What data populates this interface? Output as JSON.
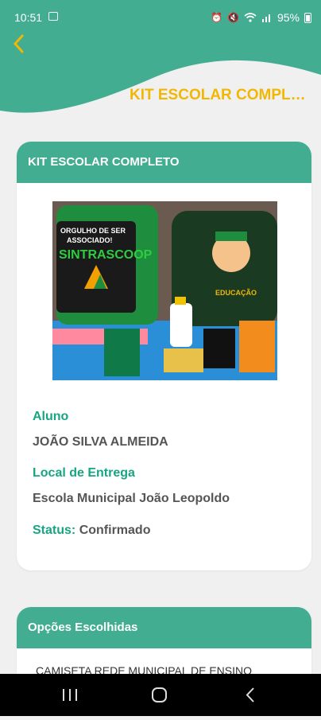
{
  "status_bar": {
    "time": "10:51",
    "battery": "95%",
    "icons": [
      "image-icon",
      "alarm-icon",
      "mute-icon",
      "wifi-icon",
      "volte-icon",
      "signal-icon",
      "battery-icon"
    ]
  },
  "header": {
    "title": "KIT ESCOLAR COMPLETO",
    "back_icon": "chevron-left-icon",
    "accent_color": "#f2b705",
    "brand_color": "#43ad91"
  },
  "kit_card": {
    "title": "KIT ESCOLAR COMPLETO",
    "image_alt": "Mochilas e material escolar",
    "aluno_label": "Aluno",
    "aluno_value": "JOÃO SILVA ALMEIDA",
    "local_label": "Local de Entrega",
    "local_value": "Escola Municipal João Leopoldo",
    "status_label": "Status:",
    "status_value": "Confirmado"
  },
  "options_card": {
    "title": "Opções Escolhidas",
    "items": [
      "CAMISETA REDE MUNICIPAL DE ENSINO"
    ]
  },
  "nav_bar": {
    "icons": [
      "recents-icon",
      "home-icon",
      "back-icon"
    ]
  }
}
